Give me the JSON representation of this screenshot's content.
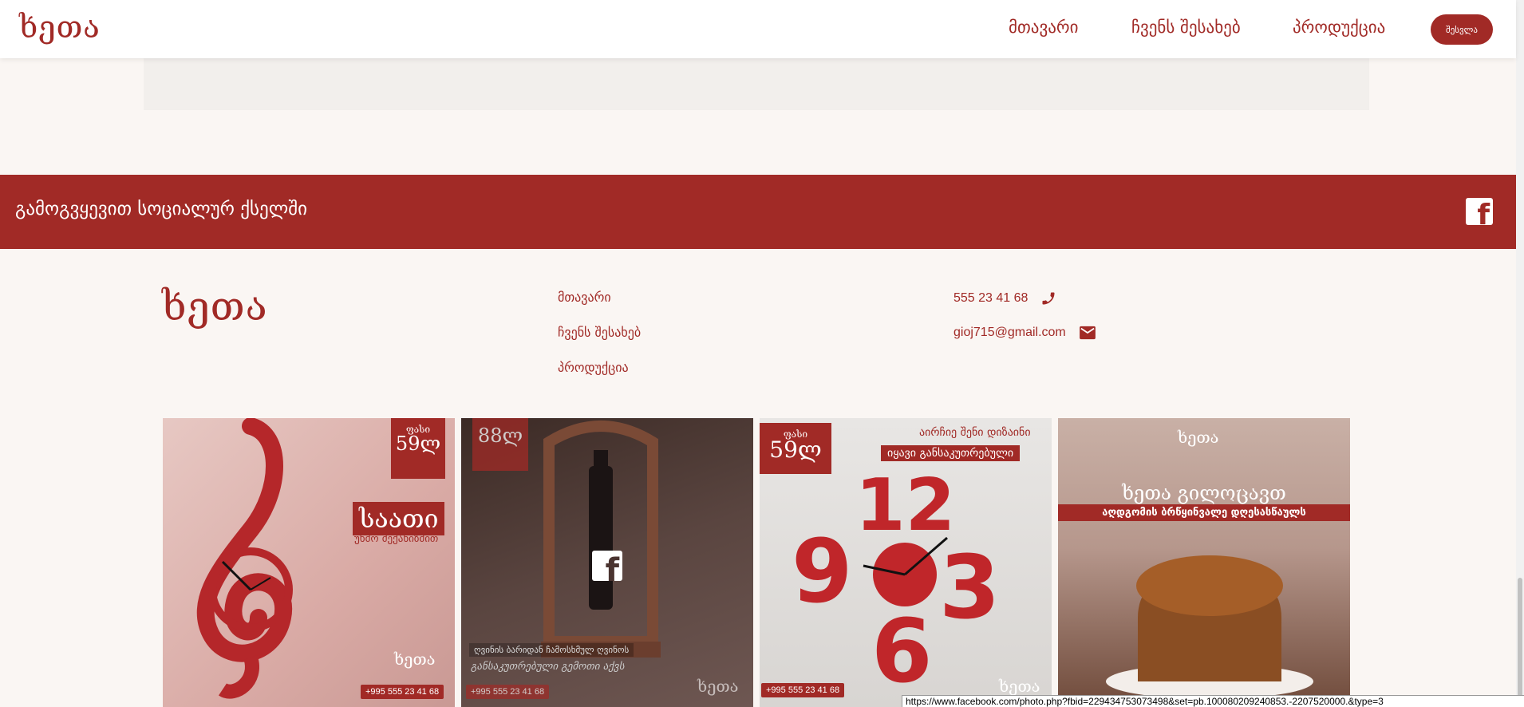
{
  "header": {
    "logo": "ხეთა",
    "nav": [
      "მთავარი",
      "ჩვენს შესახებ",
      "პროდუქცია"
    ],
    "button_label": "შესვლა"
  },
  "social": {
    "text": "გამოგვყევით სოციალურ ქსელში",
    "icon": "facebook-icon"
  },
  "footer": {
    "logo": "ხეთა",
    "links": [
      "მთავარი",
      "ჩვენს შესახებ",
      "პროდუქცია"
    ],
    "phone": "555 23 41 68",
    "email": "gioj715@gmail.com"
  },
  "gallery": [
    {
      "ribbon_small": "ფასი",
      "ribbon_big": "59ლ",
      "title": "საათი",
      "subtitle": "უხმო მექანიზმით",
      "phone": "+995 555 23 41 68",
      "logo": "ხეთა"
    },
    {
      "ribbon_big": "88ლ",
      "caption": "ღვინის ბარიდან ჩამოსხმულ ღვინოს",
      "caption2": "განსაკუთრებული გემოთი აქვს",
      "phone": "+995 555 23 41 68",
      "logo": "ხეთა"
    },
    {
      "ribbon_small": "ფასი",
      "ribbon_big": "59ლ",
      "line1": "აირჩიე შენი დიზაინი",
      "line2": "იყავი განსაკუთრებული",
      "phone": "+995 555 23 41 68",
      "logo": "ხეთა"
    },
    {
      "logo": "ხეთა",
      "title": "ხეთა გილოცავთ",
      "subtitle": "აღდგომის ბრწყინვალე დღესასწაულს"
    }
  ],
  "status_url": "https://www.facebook.com/photo.php?fbid=229434753073498&set=pb.100080209240853.-2207520000.&type=3",
  "colors": {
    "brand": "#a12a26",
    "background": "#faf6f3",
    "header_bg": "#ffffff"
  }
}
